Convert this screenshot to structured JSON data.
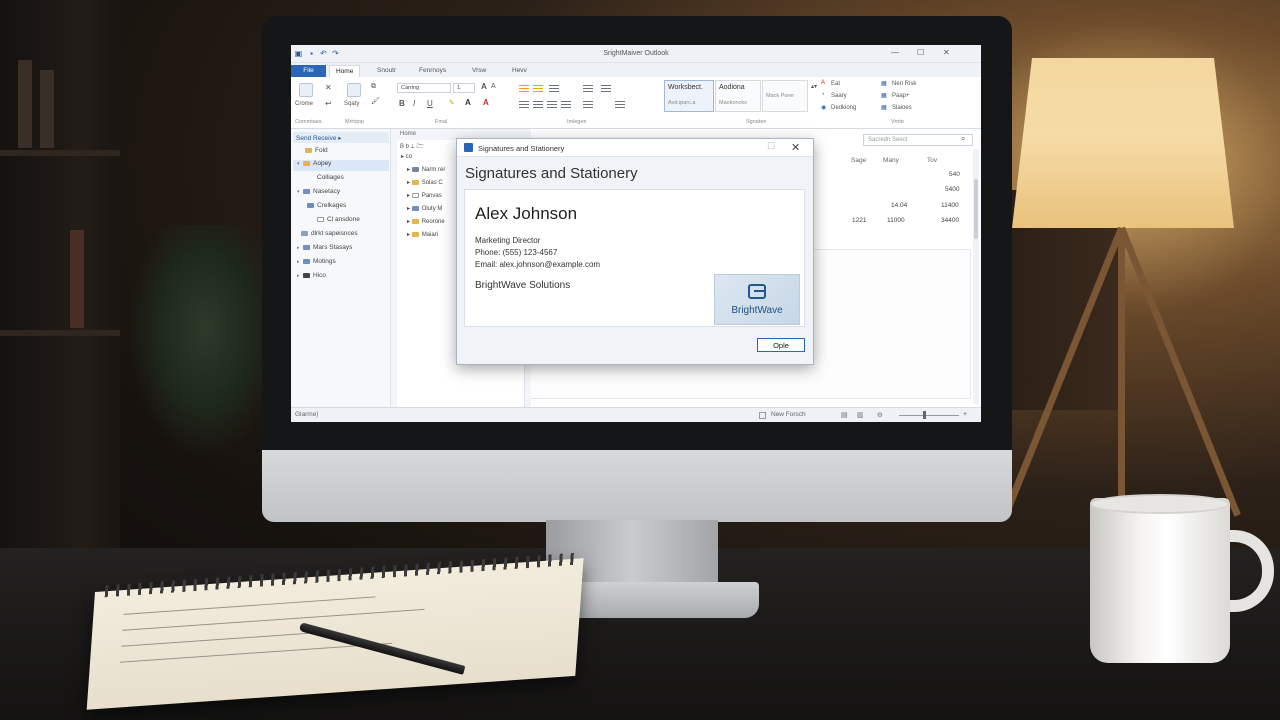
{
  "window": {
    "app_title": "SrightMaiver Outlook",
    "tabs": [
      "File",
      "Home",
      "Snoutr",
      "Fenrnoys",
      "Vrsw",
      "Hevv"
    ],
    "controls": {
      "minimize": "—",
      "maximize": "☐",
      "close": "✕"
    }
  },
  "ribbon": {
    "clipboard": {
      "label_1": "Crome",
      "label_2": "Sqaty"
    },
    "font": {
      "font_name": "Carring",
      "font_size": "1."
    },
    "styles": {
      "box_1": {
        "title": "Worksbect.",
        "sub": "Avd.iparc.a"
      },
      "box_2": {
        "title": "Aodiona",
        "sub": "Maokoncks"
      },
      "box_3": {
        "title": "",
        "sub": "Mack Porer"
      }
    },
    "right_group_1": [
      "Eat",
      "Saary",
      "Dedkiong"
    ],
    "right_group_2": [
      "Nen Risk",
      "Paap+",
      "Slaioes"
    ],
    "group_labels": [
      "Commtaes",
      "Mrrtqop",
      "Fmal",
      "Imlegen",
      "Sgnaten",
      "Vrnte"
    ]
  },
  "nav_pane": {
    "header": "Send Receive ▸",
    "items": [
      {
        "label": "Fold",
        "indent": 0,
        "caret": ""
      },
      {
        "label": "Aopey",
        "indent": 0,
        "caret": "▾"
      },
      {
        "label": "Colliages",
        "indent": 2,
        "caret": ""
      },
      {
        "label": "Nasetacy",
        "indent": 0,
        "caret": "▾"
      },
      {
        "label": "Crelkages",
        "indent": 1,
        "caret": ""
      },
      {
        "label": "Cl ansdone",
        "indent": 2,
        "caret": ""
      },
      {
        "label": "dlrkt sapeisnces",
        "indent": 0,
        "caret": ""
      },
      {
        "label": "Mars Stasays",
        "indent": 0,
        "caret": "▸"
      },
      {
        "label": "Motings",
        "indent": 0,
        "caret": "▸"
      },
      {
        "label": "Hico",
        "indent": 0,
        "caret": "▸"
      }
    ]
  },
  "folder_pane": {
    "header": "Home",
    "tools": "B  b  ⟂  🗁",
    "root": "▸ co",
    "rows": [
      "Narm rer",
      "Solas C",
      "Panvas",
      "Oluty M",
      "Reorone",
      "Maiari"
    ]
  },
  "message_list": {
    "search_placeholder": "Sacredn Seect",
    "headers": {
      "sage": "Sage",
      "many": "Many",
      "tov": "Tov"
    },
    "rows": [
      {
        "sage": "",
        "many": "",
        "tov": "540"
      },
      {
        "sage": "",
        "many": "",
        "tov": "5400"
      },
      {
        "sage": "",
        "many": "14.04",
        "tov": "11400"
      },
      {
        "sage": "1221",
        "many": "11000",
        "tov": "34400"
      }
    ]
  },
  "status_bar": {
    "left": "Glarme)",
    "view_label": "New Forsch"
  },
  "dialog": {
    "title": "Signatures and Stationery",
    "heading": "Signatures and Stationery",
    "signature": {
      "name": "Alex Johnson",
      "title": "Marketing Director",
      "phone": "Phone: (555) 123-4567",
      "email": "Email: alex.johnson@example.com",
      "company": "BrightWave Solutions",
      "logo_text": "BrightWave"
    },
    "ok_button": "Ople",
    "close": "✕"
  },
  "colors": {
    "accent": "#2b65b5",
    "logo_blue": "#1f4f86"
  }
}
